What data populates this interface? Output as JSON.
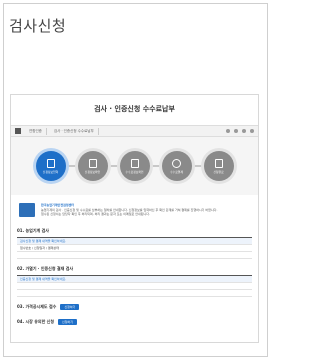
{
  "page": {
    "title": "검사신청"
  },
  "screenshot": {
    "header_title": "검사 · 인증신청 수수료납부",
    "breadcrumbs": [
      "연합인증",
      "검사 · 인증신청 수수료납부"
    ],
    "steps": [
      {
        "label": "신청정보입력",
        "icon": "document-icon",
        "active": true
      },
      {
        "label": "신청정보확인",
        "icon": "edit-document-icon",
        "active": false
      },
      {
        "label": "수수료정보확인",
        "icon": "list-icon",
        "active": false
      },
      {
        "label": "수수료결제",
        "icon": "won-icon",
        "active": false
      },
      {
        "label": "신청완료",
        "icon": "check-document-icon",
        "active": false
      }
    ],
    "info": {
      "heading": "한국농업기계안전검정센터",
      "lines": [
        "농업기계의 검사 · 인증신청 및 수수료를 납부하는 절차를 안내합니다. 신청정보를 입력하신 후 확인 단계를 거쳐 결제를 진행하시기 바랍니다.",
        "접수된 신청서는 담당자 확인 후 처리되며, 처리 결과는 문자 또는 이메일로 안내됩니다."
      ]
    },
    "sections": [
      {
        "title": "01. 농업기계 검사",
        "button": "",
        "rows": [
          {
            "highlight": true,
            "cells": [
              "검사신청 및 결제 내역을 확인하세요."
            ]
          },
          {
            "highlight": false,
            "cells": [
              "접수번호 / 신청일자 / 결제상태",
              ""
            ]
          },
          {
            "highlight": false,
            "cells": [
              "",
              ""
            ]
          }
        ]
      },
      {
        "title": "02. 가열기 · 인증신청 결재 검사",
        "button": "",
        "rows": [
          {
            "highlight": true,
            "cells": [
              "인증신청 및 결제 내역을 확인하세요."
            ]
          },
          {
            "highlight": false,
            "cells": [
              "",
              ""
            ]
          },
          {
            "highlight": false,
            "cells": [
              "",
              ""
            ]
          }
        ]
      },
      {
        "title": "03. 가격공시제도 접수",
        "button": "신청하기",
        "rows": []
      },
      {
        "title": "04. 시장 유의한 신청",
        "button": "신청하기",
        "rows": []
      }
    ]
  }
}
